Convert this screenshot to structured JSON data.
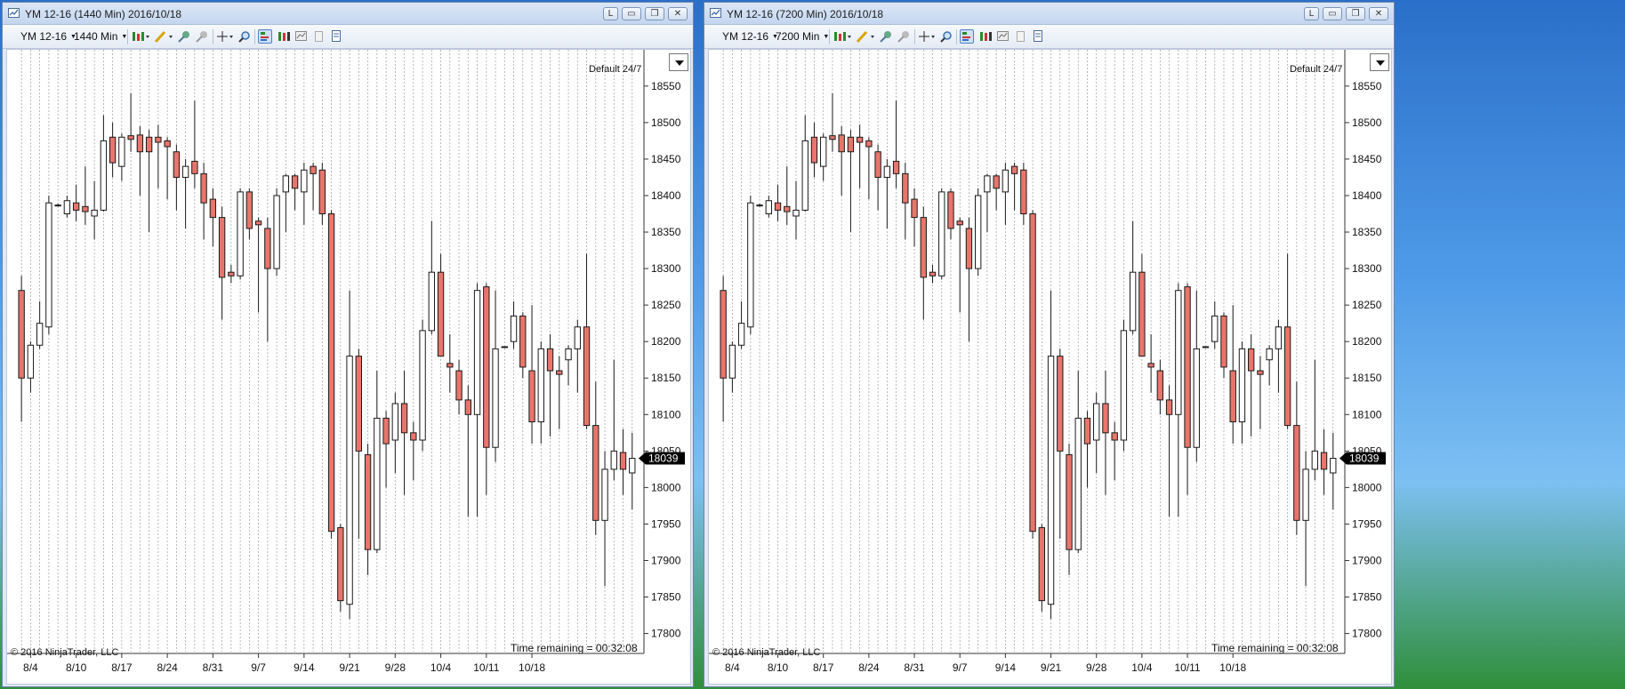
{
  "windows": [
    {
      "title": "YM 12-16 (1440 Min)  2016/10/18",
      "instrument": "YM 12-16",
      "period": "1440 Min",
      "session": "Default 24/7",
      "copyright": "© 2016 NinjaTrader, LLC",
      "time_remaining": "Time remaining = 00:32:08"
    },
    {
      "title": "YM 12-16 (7200 Min)  2016/10/18",
      "instrument": "YM 12-16",
      "period": "7200 Min",
      "session": "Default 24/7",
      "copyright": "© 2016 NinjaTrader, LLC",
      "time_remaining": "Time remaining = 00:32:08"
    }
  ],
  "window_buttons": {
    "link": "L",
    "minimize": "▭",
    "restore": "❐",
    "close": "✕"
  },
  "icons": [
    "chart-style-icon",
    "draw-pencil-icon",
    "add-indicator-icon",
    "strategy-icon",
    "crosshair-icon",
    "zoom-icon",
    "data-box-icon",
    "bar-select-icon",
    "chart-properties-icon",
    "page-icon",
    "strategy-list-icon"
  ],
  "colors": {
    "down_candle": "#e8756b",
    "up_candle": "#ffffff",
    "wick": "#1a1a1a",
    "price_marker": "#000000"
  },
  "chart_data": {
    "type": "candlestick",
    "x_labels": [
      "8/4",
      "8/10",
      "8/17",
      "8/24",
      "8/31",
      "9/7",
      "9/14",
      "9/21",
      "9/28",
      "10/4",
      "10/11",
      "10/18"
    ],
    "y_ticks": [
      17800,
      17850,
      17900,
      17950,
      18000,
      18050,
      18100,
      18150,
      18200,
      18250,
      18300,
      18350,
      18400,
      18450,
      18500,
      18550
    ],
    "ylim": [
      17780,
      18590
    ],
    "current_price": "18039",
    "candles": [
      {
        "o": 18270,
        "h": 18290,
        "l": 18090,
        "c": 18150
      },
      {
        "o": 18150,
        "h": 18200,
        "l": 18130,
        "c": 18195
      },
      {
        "o": 18195,
        "h": 18255,
        "l": 18190,
        "c": 18225
      },
      {
        "o": 18220,
        "h": 18400,
        "l": 18210,
        "c": 18390
      },
      {
        "o": 18387,
        "h": 18389,
        "l": 18385,
        "c": 18387
      },
      {
        "o": 18375,
        "h": 18400,
        "l": 18370,
        "c": 18393
      },
      {
        "o": 18390,
        "h": 18415,
        "l": 18365,
        "c": 18380
      },
      {
        "o": 18385,
        "h": 18440,
        "l": 18360,
        "c": 18378
      },
      {
        "o": 18372,
        "h": 18420,
        "l": 18340,
        "c": 18380
      },
      {
        "o": 18380,
        "h": 18510,
        "l": 18378,
        "c": 18475
      },
      {
        "o": 18480,
        "h": 18500,
        "l": 18425,
        "c": 18445
      },
      {
        "o": 18440,
        "h": 18485,
        "l": 18420,
        "c": 18480
      },
      {
        "o": 18482,
        "h": 18540,
        "l": 18460,
        "c": 18477
      },
      {
        "o": 18483,
        "h": 18495,
        "l": 18400,
        "c": 18460
      },
      {
        "o": 18480,
        "h": 18490,
        "l": 18350,
        "c": 18460
      },
      {
        "o": 18480,
        "h": 18497,
        "l": 18410,
        "c": 18473
      },
      {
        "o": 18475,
        "h": 18480,
        "l": 18395,
        "c": 18467
      },
      {
        "o": 18460,
        "h": 18470,
        "l": 18380,
        "c": 18425
      },
      {
        "o": 18425,
        "h": 18450,
        "l": 18355,
        "c": 18440
      },
      {
        "o": 18447,
        "h": 18530,
        "l": 18410,
        "c": 18430
      },
      {
        "o": 18430,
        "h": 18445,
        "l": 18340,
        "c": 18390
      },
      {
        "o": 18395,
        "h": 18410,
        "l": 18330,
        "c": 18370
      },
      {
        "o": 18370,
        "h": 18385,
        "l": 18230,
        "c": 18288
      },
      {
        "o": 18295,
        "h": 18305,
        "l": 18280,
        "c": 18290
      },
      {
        "o": 18290,
        "h": 18410,
        "l": 18285,
        "c": 18405
      },
      {
        "o": 18405,
        "h": 18410,
        "l": 18340,
        "c": 18355
      },
      {
        "o": 18365,
        "h": 18370,
        "l": 18240,
        "c": 18360
      },
      {
        "o": 18355,
        "h": 18370,
        "l": 18200,
        "c": 18300
      },
      {
        "o": 18300,
        "h": 18410,
        "l": 18290,
        "c": 18400
      },
      {
        "o": 18405,
        "h": 18430,
        "l": 18350,
        "c": 18427
      },
      {
        "o": 18427,
        "h": 18430,
        "l": 18380,
        "c": 18410
      },
      {
        "o": 18405,
        "h": 18445,
        "l": 18360,
        "c": 18435
      },
      {
        "o": 18440,
        "h": 18445,
        "l": 18380,
        "c": 18430
      },
      {
        "o": 18435,
        "h": 18445,
        "l": 18360,
        "c": 18375
      },
      {
        "o": 18375,
        "h": 18380,
        "l": 17930,
        "c": 17940
      },
      {
        "o": 17945,
        "h": 17950,
        "l": 17830,
        "c": 17845
      },
      {
        "o": 17840,
        "h": 18270,
        "l": 17820,
        "c": 18180
      },
      {
        "o": 18180,
        "h": 18190,
        "l": 17930,
        "c": 18050
      },
      {
        "o": 18045,
        "h": 18060,
        "l": 17880,
        "c": 17915
      },
      {
        "o": 17915,
        "h": 18160,
        "l": 17910,
        "c": 18095
      },
      {
        "o": 18095,
        "h": 18105,
        "l": 18000,
        "c": 18060
      },
      {
        "o": 18065,
        "h": 18130,
        "l": 18020,
        "c": 18115
      },
      {
        "o": 18115,
        "h": 18160,
        "l": 17990,
        "c": 18075
      },
      {
        "o": 18075,
        "h": 18090,
        "l": 18010,
        "c": 18065
      },
      {
        "o": 18065,
        "h": 18230,
        "l": 18050,
        "c": 18215
      },
      {
        "o": 18215,
        "h": 18365,
        "l": 18210,
        "c": 18295
      },
      {
        "o": 18295,
        "h": 18320,
        "l": 18200,
        "c": 18180
      },
      {
        "o": 18170,
        "h": 18210,
        "l": 18130,
        "c": 18165
      },
      {
        "o": 18160,
        "h": 18175,
        "l": 18100,
        "c": 18120
      },
      {
        "o": 18120,
        "h": 18140,
        "l": 17960,
        "c": 18100
      },
      {
        "o": 18100,
        "h": 18280,
        "l": 17960,
        "c": 18270
      },
      {
        "o": 18275,
        "h": 18280,
        "l": 17990,
        "c": 18055
      },
      {
        "o": 18055,
        "h": 18270,
        "l": 18035,
        "c": 18190
      },
      {
        "o": 18193,
        "h": 18193,
        "l": 18191,
        "c": 18193
      },
      {
        "o": 18200,
        "h": 18255,
        "l": 18190,
        "c": 18235
      },
      {
        "o": 18235,
        "h": 18240,
        "l": 18150,
        "c": 18165
      },
      {
        "o": 18160,
        "h": 18250,
        "l": 18060,
        "c": 18090
      },
      {
        "o": 18090,
        "h": 18200,
        "l": 18060,
        "c": 18190
      },
      {
        "o": 18190,
        "h": 18210,
        "l": 18070,
        "c": 18160
      },
      {
        "o": 18160,
        "h": 18180,
        "l": 18080,
        "c": 18155
      },
      {
        "o": 18175,
        "h": 18195,
        "l": 18140,
        "c": 18190
      },
      {
        "o": 18190,
        "h": 18230,
        "l": 18130,
        "c": 18220
      },
      {
        "o": 18220,
        "h": 18320,
        "l": 18080,
        "c": 18085
      },
      {
        "o": 18085,
        "h": 18145,
        "l": 17935,
        "c": 17955
      },
      {
        "o": 17955,
        "h": 18050,
        "l": 17865,
        "c": 18025
      },
      {
        "o": 18025,
        "h": 18175,
        "l": 18010,
        "c": 18050
      },
      {
        "o": 18048,
        "h": 18080,
        "l": 17990,
        "c": 18025
      },
      {
        "o": 18020,
        "h": 18075,
        "l": 17970,
        "c": 18040
      }
    ]
  }
}
